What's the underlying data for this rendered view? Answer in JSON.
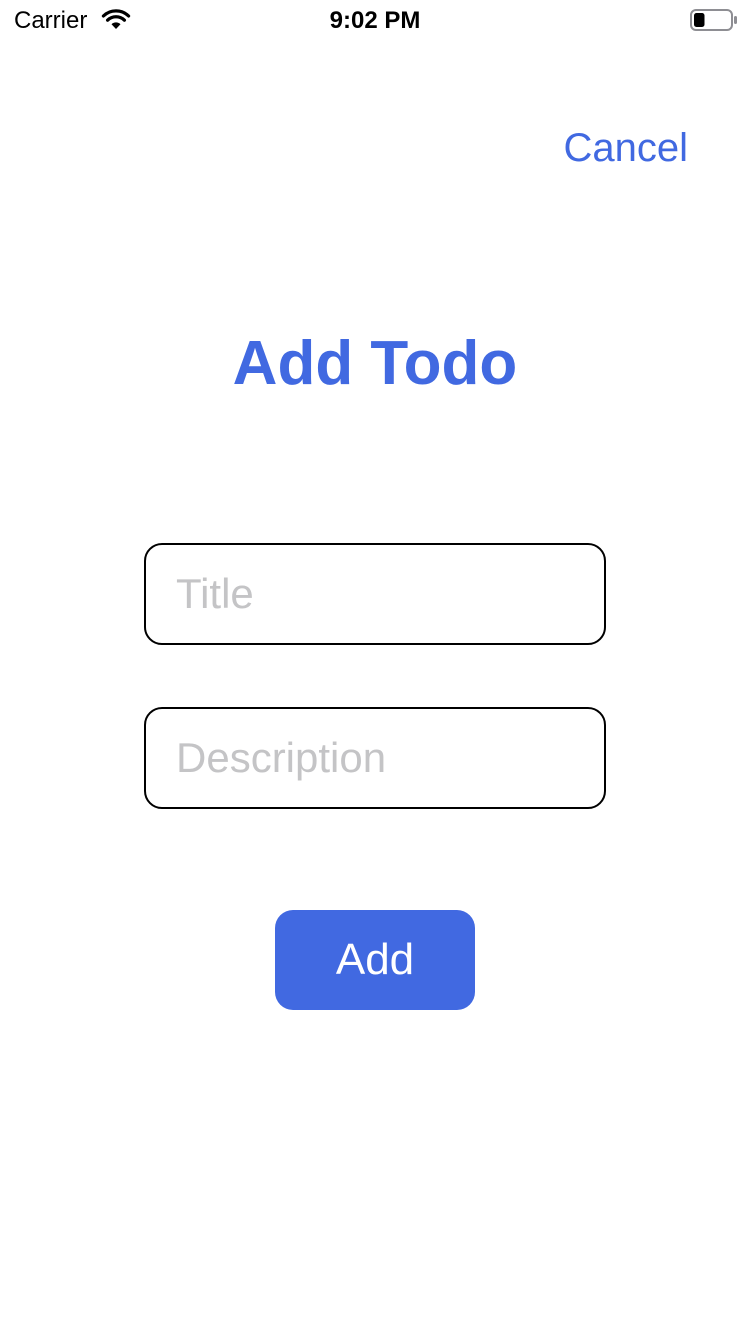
{
  "status_bar": {
    "carrier": "Carrier",
    "time": "9:02 PM",
    "wifi_icon": "wifi-icon",
    "battery_icon": "battery-icon",
    "battery_level": 0.3
  },
  "nav": {
    "cancel_label": "Cancel"
  },
  "page": {
    "title": "Add Todo"
  },
  "form": {
    "title_value": "",
    "title_placeholder": "Title",
    "description_value": "",
    "description_placeholder": "Description",
    "add_label": "Add"
  },
  "colors": {
    "accent": "#4169e1",
    "placeholder": "#c4c4c6",
    "border": "#000000",
    "background": "#ffffff"
  }
}
